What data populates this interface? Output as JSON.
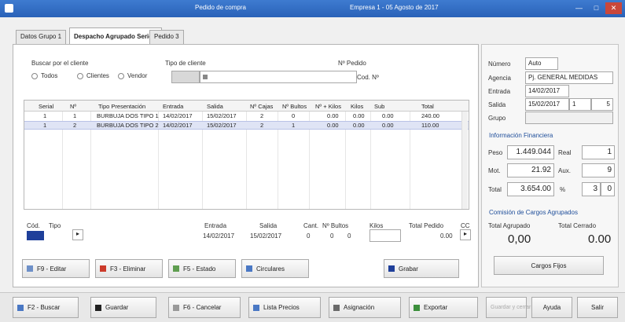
{
  "window": {
    "title": "Pedido de compra",
    "subtitle": "Empresa 1 - 05 Agosto de 2017"
  },
  "tabs": [
    {
      "label": "Datos Grupo 1"
    },
    {
      "label": "Despacho Agrupado Serie 2"
    },
    {
      "label": "Pedido 3"
    }
  ],
  "form": {
    "buscar_label": "Buscar por el cliente",
    "tipo_label": "Tipo de cliente",
    "nro_label": "Nº Pedido",
    "radio_all": "Todos",
    "radio_client": "Clientes",
    "radio_seller": "Vendor",
    "cod_label": "Cod. Nº"
  },
  "grid": {
    "headers": [
      "Serial",
      "Nº",
      "Tipo Presentación",
      "Entrada",
      "Salida",
      "Nº Cajas",
      "Nº Bultos",
      "Nº + Kilos",
      "Kilos",
      "Sub",
      "Total"
    ],
    "rows": [
      [
        "1",
        "1",
        "BURBUJA DOS TIPO 1",
        "14/02/2017",
        "15/02/2017",
        "2",
        "0",
        "0.00",
        "0.00",
        "0.00",
        "240.00"
      ],
      [
        "1",
        "2",
        "BURBUJA DOS TIPO 2",
        "14/02/2017",
        "15/02/2017",
        "2",
        "1",
        "0.00",
        "0.00",
        "0.00",
        "110.00"
      ]
    ]
  },
  "footer": {
    "col1": "Cód.",
    "col2": "Tipo",
    "entrada_label": "Entrada",
    "salida_label": "Salida",
    "cant_label": "Cant.",
    "bultos_label": "Nº Bultos",
    "kilos_label": "Kilos",
    "total_label": "Total Pedido",
    "cod_extra": "CC",
    "entrada": "14/02/2017",
    "salida": "15/02/2017",
    "cant": "0",
    "bultos": "0",
    "kilos": "0",
    "total": "0.00"
  },
  "actions": [
    {
      "label": "F9 - Editar"
    },
    {
      "label": "F3 - Eliminar"
    },
    {
      "label": "F5 - Estado"
    },
    {
      "label": "Circulares"
    },
    {
      "label": "Grabar"
    }
  ],
  "side": {
    "numero_label": "Número",
    "numero": "Auto",
    "agencia_label": "Agencia",
    "agencia": "Pj. GENERAL MEDIDAS",
    "entrada_label": "Entrada",
    "entrada": "14/02/2017",
    "salida_label": "Salida",
    "salida": "15/02/2017",
    "salida_n": "1",
    "salida_m": "5",
    "grupo_label": "Grupo",
    "sec1": "Información Financiera",
    "peso_label": "Peso",
    "peso": "1.449.044",
    "peso_r_label": "Real",
    "peso_r": "1",
    "mot_label": "Mot.",
    "mot": "21.92",
    "mot_r_label": "Aux.",
    "mot_r": "9",
    "total_label": "Total",
    "total": "3.654.00",
    "total_r_label": "%",
    "total_a": "3",
    "total_b": "0",
    "sec2": "Comisión de Cargos Agrupados",
    "ag_label": "Total Agrupado",
    "ag_val": "0,00",
    "cerrar_label": "Total Cerrado",
    "cerrar_val": "0.00",
    "cargos_btn": "Cargos Fijos"
  },
  "bottom": [
    {
      "label": "F2 - Buscar"
    },
    {
      "label": "Guardar"
    },
    {
      "label": "F6 - Cancelar"
    },
    {
      "label": "Lista Precios"
    },
    {
      "label": "Asignación"
    },
    {
      "label": "Exportar"
    },
    {
      "label": "Guardar y cerrar"
    },
    {
      "label": "Ayuda"
    },
    {
      "label": "Salir"
    }
  ]
}
